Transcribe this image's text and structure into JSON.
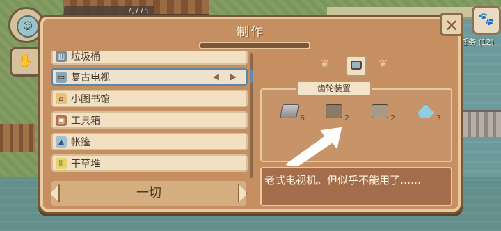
{
  "hud": {
    "coin_count": "7,775",
    "task_label": "任务 (12)"
  },
  "panel": {
    "title": "制作"
  },
  "recipe_list": {
    "items": [
      {
        "label": "垃圾桶",
        "icon": "trash-bin-icon",
        "selected": false
      },
      {
        "label": "复古电视",
        "icon": "retro-tv-icon",
        "selected": true
      },
      {
        "label": "小图书馆",
        "icon": "little-library-icon",
        "selected": false
      },
      {
        "label": "工具箱",
        "icon": "toolbox-icon",
        "selected": false
      },
      {
        "label": "帐篷",
        "icon": "tent-icon",
        "selected": false
      },
      {
        "label": "干草堆",
        "icon": "haystack-icon",
        "selected": false
      }
    ],
    "selected_arrows": "◀ ▶"
  },
  "filter": {
    "label": "一切"
  },
  "detail": {
    "item_icon": "retro-tv-icon",
    "tooltip": "齿轮装置",
    "materials": [
      {
        "icon": "iron-ingot-icon",
        "qty": "6"
      },
      {
        "icon": "gear-device-icon",
        "qty": "2"
      },
      {
        "icon": "circuit-part-icon",
        "qty": "2"
      },
      {
        "icon": "crystal-icon",
        "qty": "3"
      }
    ],
    "description": "老式电视机。但似乎不能用了……"
  }
}
